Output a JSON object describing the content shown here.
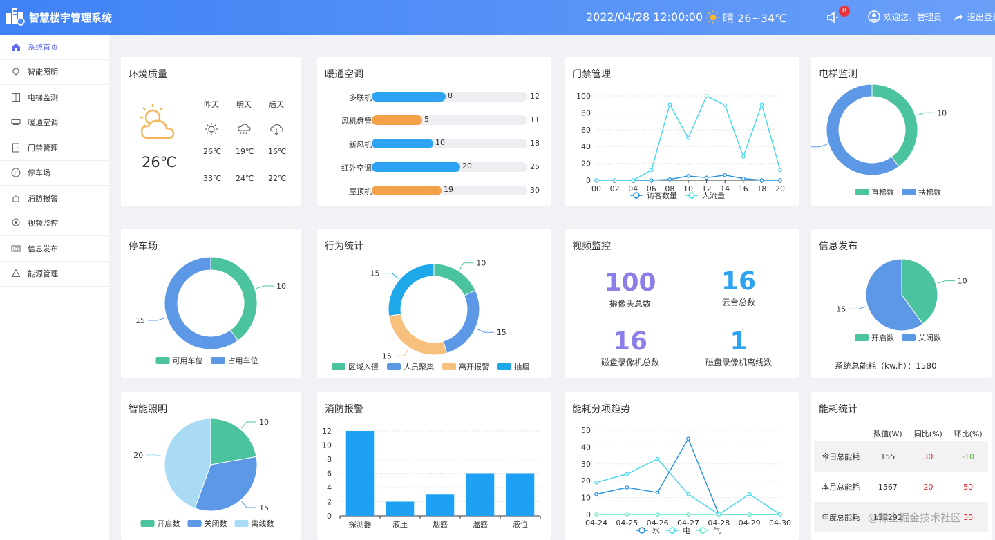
{
  "header": {
    "app_title": "智慧楼宇管理系统",
    "datetime": "2022/04/28 12:00:00",
    "weather": "晴 26~34℃",
    "notification_count": "8",
    "welcome": "欢迎您，管理员",
    "logout": "退出登录"
  },
  "sidebar": {
    "items": [
      {
        "label": "系统首页",
        "icon": "home-icon"
      },
      {
        "label": "智能照明",
        "icon": "bulb-icon"
      },
      {
        "label": "电梯监测",
        "icon": "elevator-icon"
      },
      {
        "label": "暖通空调",
        "icon": "ac-icon"
      },
      {
        "label": "门禁管理",
        "icon": "door-icon"
      },
      {
        "label": "停车场",
        "icon": "parking-icon"
      },
      {
        "label": "消防报警",
        "icon": "alarm-icon"
      },
      {
        "label": "视频监控",
        "icon": "camera-icon"
      },
      {
        "label": "信息发布",
        "icon": "led-icon"
      },
      {
        "label": "能源管理",
        "icon": "recycle-icon"
      }
    ]
  },
  "env": {
    "title": "环境质量",
    "current_temp": "26℃",
    "days": [
      {
        "label": "昨天",
        "icon": "sun-icon",
        "low": "26℃",
        "high": "33℃"
      },
      {
        "label": "明天",
        "icon": "rain-cloud-icon",
        "low": "19℃",
        "high": "24℃"
      },
      {
        "label": "后天",
        "icon": "cloud-download-icon",
        "low": "16℃",
        "high": "22℃"
      }
    ]
  },
  "hvac": {
    "title": "暖通空调",
    "colors": {
      "blue": "#2ea3f2",
      "orange": "#f5a14a"
    },
    "rows": [
      {
        "label": "多联机",
        "value": 8,
        "max": 12,
        "color": "blue"
      },
      {
        "label": "风机盘管",
        "value": 5,
        "max": 11,
        "color": "orange"
      },
      {
        "label": "新风机",
        "value": 10,
        "max": 18,
        "color": "blue"
      },
      {
        "label": "红外空调",
        "value": 20,
        "max": 25,
        "color": "blue"
      },
      {
        "label": "屋顶机",
        "value": 19,
        "max": 30,
        "color": "orange"
      }
    ]
  },
  "access": {
    "title": "门禁管理"
  },
  "elevator": {
    "title": "电梯监测"
  },
  "parking": {
    "title": "停车场"
  },
  "behavior": {
    "title": "行为统计"
  },
  "video": {
    "title": "视频监控",
    "stats": [
      {
        "value": "100",
        "label": "摄像头总数",
        "color": "#8b7fe8"
      },
      {
        "value": "16",
        "label": "云台总数",
        "color": "#2ea3f2"
      },
      {
        "value": "16",
        "label": "磁盘录像机总数",
        "color": "#8b7fe8"
      },
      {
        "value": "1",
        "label": "磁盘录像机离线数",
        "color": "#2ea3f2"
      }
    ]
  },
  "info": {
    "title": "信息发布",
    "energy_label": "系统总能耗（kw.h）：",
    "energy_value": "1580"
  },
  "lighting": {
    "title": "智能照明"
  },
  "fire": {
    "title": "消防报警"
  },
  "trend": {
    "title": "能耗分项趋势"
  },
  "energy_stats": {
    "title": "能耗统计",
    "headers": [
      "",
      "数值(W)",
      "同比(%)",
      "环比(%)"
    ],
    "rows": [
      {
        "label": "今日总能耗",
        "value": "155",
        "yoy": "30",
        "mom": "-10"
      },
      {
        "label": "本月总能耗",
        "value": "1567",
        "yoy": "20",
        "mom": "50"
      },
      {
        "label": "年度总能耗",
        "value": "128292",
        "yoy": "",
        "mom": "30"
      }
    ],
    "colors": {
      "up": "#e02020",
      "down": "#52b031"
    }
  },
  "watermark": "@稀土掘金技术社区",
  "chart_data": [
    {
      "id": "access",
      "type": "line",
      "x": [
        "00",
        "02",
        "04",
        "06",
        "08",
        "10",
        "12",
        "14",
        "16",
        "18",
        "20"
      ],
      "ylim": [
        0,
        100
      ],
      "yticks": [
        0,
        20,
        40,
        60,
        80,
        100
      ],
      "legend": "bottom",
      "series": [
        {
          "name": "访客数量",
          "color": "#1f8fe0",
          "values": [
            0,
            0,
            0,
            0,
            1,
            5,
            3,
            6,
            2,
            0,
            0
          ]
        },
        {
          "name": "人流量",
          "color": "#3fd7f0",
          "values": [
            0,
            0,
            0,
            12,
            90,
            50,
            100,
            89,
            28,
            90,
            12
          ]
        }
      ]
    },
    {
      "id": "elevator",
      "type": "pie",
      "donut": true,
      "legend": "bottom",
      "slices": [
        {
          "name": "直梯数",
          "value": 10,
          "color": "#4cc39f"
        },
        {
          "name": "扶梯数",
          "value": 15,
          "color": "#5d98e6"
        }
      ]
    },
    {
      "id": "parking",
      "type": "pie",
      "donut": true,
      "legend": "bottom",
      "slices": [
        {
          "name": "可用车位",
          "value": 10,
          "color": "#4cc39f"
        },
        {
          "name": "占用车位",
          "value": 15,
          "color": "#5d98e6"
        }
      ]
    },
    {
      "id": "behavior",
      "type": "pie",
      "donut": true,
      "legend": "bottom",
      "slices": [
        {
          "name": "区域入侵",
          "value": 10,
          "color": "#4cc39f"
        },
        {
          "name": "人员聚集",
          "value": 15,
          "color": "#5d98e6"
        },
        {
          "name": "离开报警",
          "value": 15,
          "color": "#f7c07c"
        },
        {
          "name": "抽烟",
          "value": 15,
          "color": "#1ea8ea"
        }
      ]
    },
    {
      "id": "info",
      "type": "pie",
      "donut": false,
      "legend": "bottom",
      "slices": [
        {
          "name": "开启数",
          "value": 10,
          "color": "#4cc39f"
        },
        {
          "name": "关闭数",
          "value": 15,
          "color": "#5d98e6"
        }
      ]
    },
    {
      "id": "lighting",
      "type": "pie",
      "donut": false,
      "legend": "bottom",
      "slices": [
        {
          "name": "开启数",
          "value": 10,
          "color": "#4cc39f"
        },
        {
          "name": "关闭数",
          "value": 15,
          "color": "#5d98e6"
        },
        {
          "name": "离线数",
          "value": 20,
          "color": "#a9dcf4"
        }
      ]
    },
    {
      "id": "fire",
      "type": "bar",
      "categories": [
        "探测器",
        "液压",
        "烟感",
        "温感",
        "液位"
      ],
      "values": [
        12,
        2,
        3,
        6,
        6
      ],
      "ylim": [
        0,
        12
      ],
      "yticks": [
        0,
        2,
        4,
        6,
        8,
        10,
        12
      ],
      "color": "#1ea1f2"
    },
    {
      "id": "trend",
      "type": "line",
      "x": [
        "04-24",
        "04-25",
        "04-26",
        "04-27",
        "04-28",
        "04-29",
        "04-30"
      ],
      "ylim": [
        0,
        50
      ],
      "yticks": [
        0,
        10,
        20,
        30,
        40,
        50
      ],
      "legend": "bottom",
      "series": [
        {
          "name": "水",
          "color": "#1f8fe0",
          "values": [
            12,
            16,
            13,
            45,
            0,
            0,
            0
          ]
        },
        {
          "name": "电",
          "color": "#3fd7f0",
          "values": [
            19,
            24,
            33,
            12,
            0,
            12,
            0
          ]
        },
        {
          "name": "气",
          "color": "#5ee8c8",
          "values": [
            0,
            0,
            0,
            0,
            0,
            0,
            0
          ]
        }
      ]
    }
  ]
}
